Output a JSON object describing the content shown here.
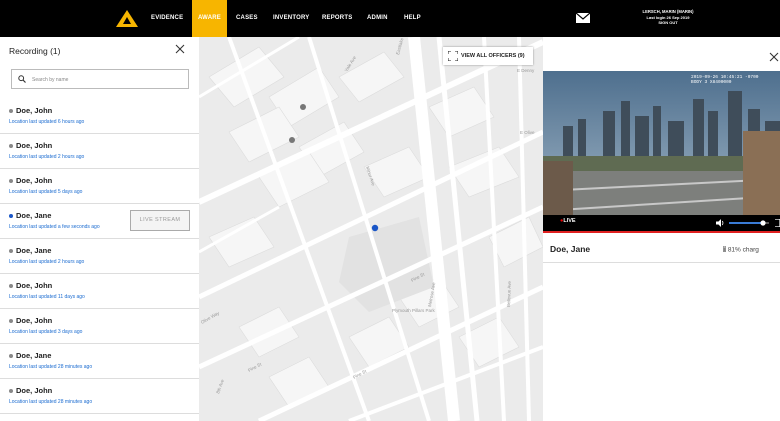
{
  "header": {
    "nav": [
      "EVIDENCE",
      "AWARE",
      "CASES",
      "INVENTORY",
      "REPORTS",
      "ADMIN",
      "HELP"
    ],
    "active_nav": "AWARE",
    "user": {
      "name": "LERSCH, MARIN (MARIN)",
      "last_login": "Last login 26 Sep 2019",
      "sign_out": "SIGN OUT"
    },
    "accent_color": "#f7b500"
  },
  "sidebar": {
    "title": "Recording (1)",
    "search_placeholder": "Search by name",
    "items": [
      {
        "name": "Doe, John",
        "location": "Location last updated 6 hours ago",
        "status": "inactive"
      },
      {
        "name": "Doe, John",
        "location": "Location last updated 2 hours ago",
        "status": "inactive"
      },
      {
        "name": "Doe, John",
        "location": "Location last updated 5 days ago",
        "status": "inactive"
      },
      {
        "name": "Doe, Jane",
        "location": "Location last updated a few seconds ago",
        "status": "live",
        "button": "LIVE STREAM"
      },
      {
        "name": "Doe, Jane",
        "location": "Location last updated 2 hours ago",
        "status": "inactive"
      },
      {
        "name": "Doe, John",
        "location": "Location last updated 11 days ago",
        "status": "inactive"
      },
      {
        "name": "Doe, John",
        "location": "Location last updated 3 days ago",
        "status": "inactive"
      },
      {
        "name": "Doe, Jane",
        "location": "Location last updated 28 minutes ago",
        "status": "inactive"
      },
      {
        "name": "Doe, John",
        "location": "Location last updated 28 minutes ago",
        "status": "inactive"
      }
    ]
  },
  "map": {
    "view_all_label": "VIEW ALL OFFICERS (9)",
    "street_labels": [
      "Yale Ave",
      "Eastlake",
      "Pine St",
      "Pine St",
      "Pine St",
      "Minor Ave",
      "Melrose Ave",
      "Bellevue Ave",
      "Olive Way",
      "8th Ave",
      "Plymouth Pillars Park",
      "E Olive",
      "E Denny"
    ]
  },
  "video_panel": {
    "timestamp_line1": "2019-09-26 10:45:21 -0700",
    "timestamp_line2": "BODY 3 X8400000",
    "live_label": "LIVE",
    "officer_name": "Doe, Jane",
    "charge": "81% charg",
    "volume_level": 0.85
  }
}
